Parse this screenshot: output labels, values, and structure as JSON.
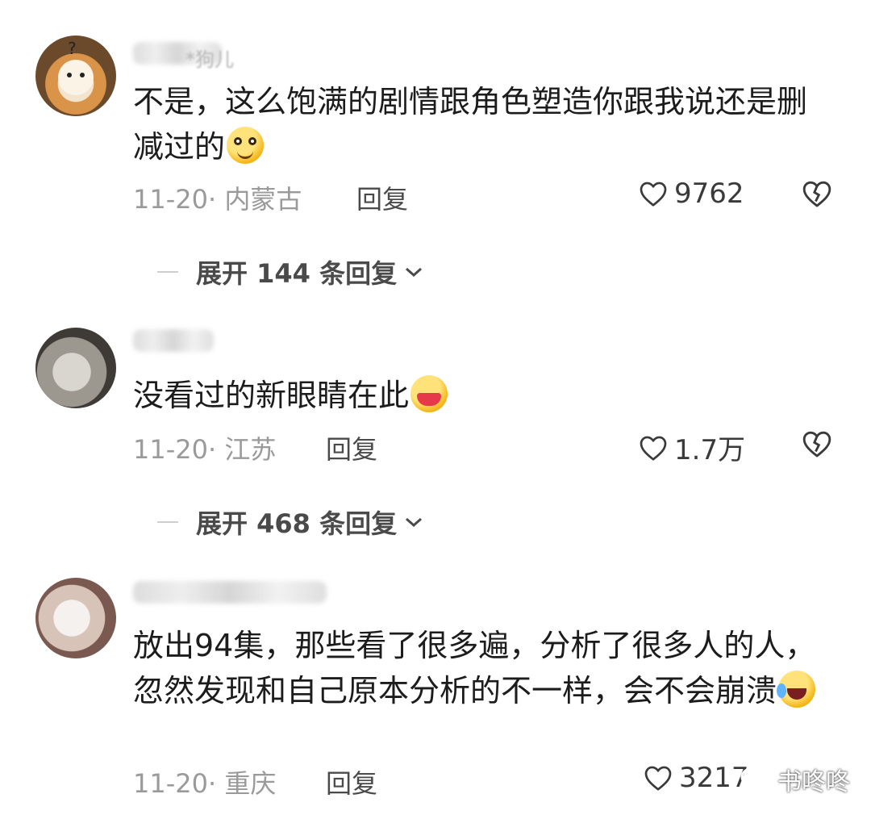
{
  "comments": [
    {
      "name": "*狗儿",
      "text": "不是，这么饱满的剧情跟角色塑造你跟我说还是删减过的",
      "emoji": "smile-emoji",
      "meta": "11-20· 内蒙古",
      "reply_label": "回复",
      "likes": "9762",
      "expand_label": "展开 144 条回复"
    },
    {
      "name": "",
      "text": "没看过的新眼睛在此",
      "emoji": "noodle-bowl-emoji",
      "meta": "11-20· 江苏",
      "reply_label": "回复",
      "likes": "1.7万",
      "expand_label": "展开 468 条回复"
    },
    {
      "name": "",
      "text": "放出94集，那些看了很多遍，分析了很多人的人，忽然发现和自己原本分析的不一样，会不会崩溃",
      "emoji": "laugh-tears-emoji",
      "meta": "11-20· 重庆",
      "reply_label": "回复",
      "likes": "3217"
    }
  ],
  "watermark": {
    "label": "书咚咚",
    "icon": "wechat-icon"
  },
  "colors": {
    "text": "#1c1c1c",
    "meta": "#9a9a9a",
    "action": "#4a4a4a"
  }
}
